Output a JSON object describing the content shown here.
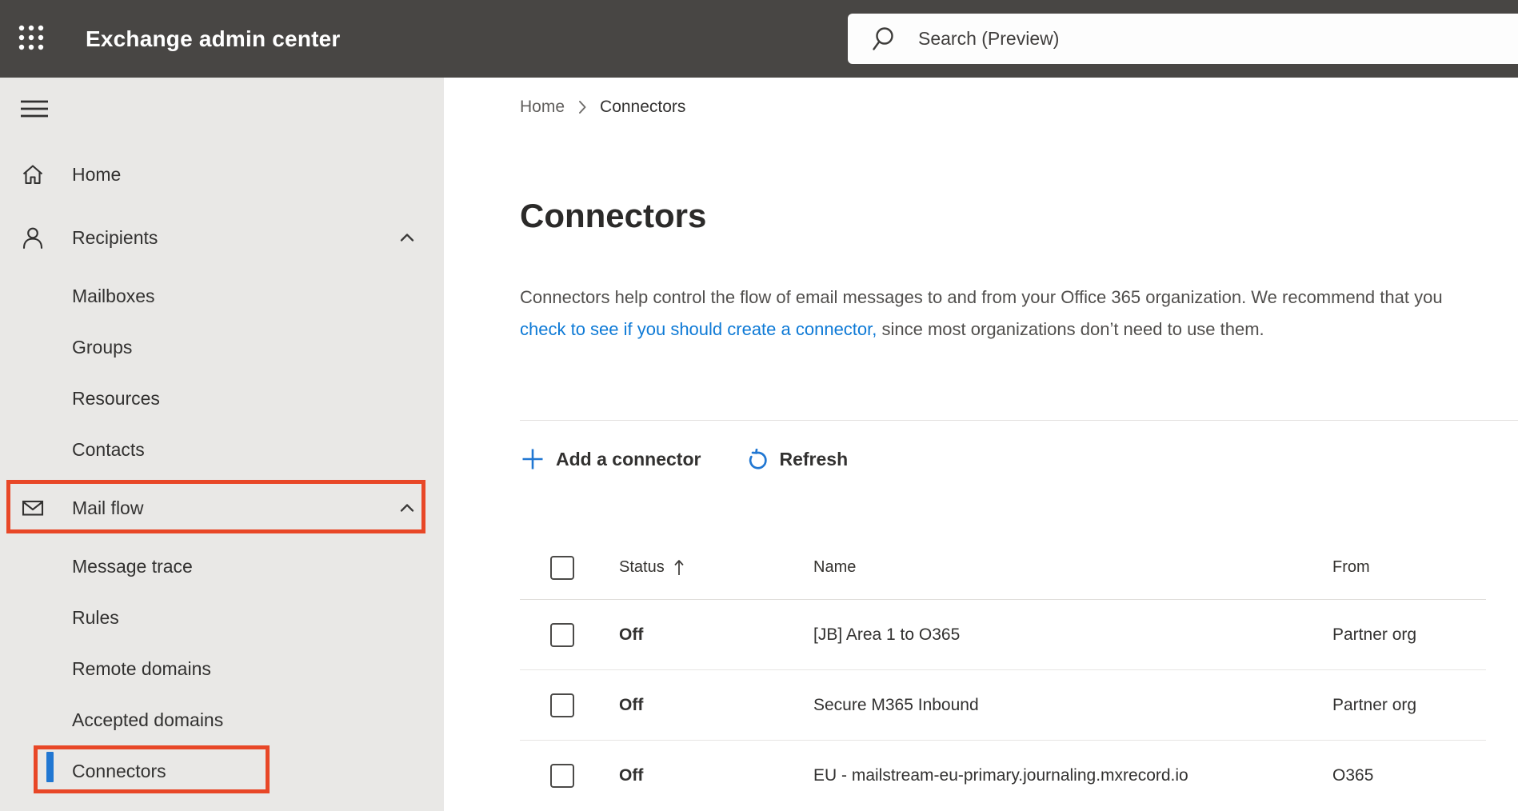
{
  "topbar": {
    "app_title": "Exchange admin center",
    "search_placeholder": "Search (Preview)"
  },
  "icons": {
    "app_launcher": "grid-3x3-dots",
    "search": "magnifier",
    "menu": "hamburger",
    "home": "house-outline",
    "recipients": "person-outline",
    "mail_flow": "envelope-outline",
    "collapse": "chevron-up",
    "breadcrumb_separator": "chevron-right",
    "add": "plus",
    "refresh": "circular-arrow",
    "sort": "arrow-up"
  },
  "colors": {
    "topbar_bg": "#484644",
    "sidebar_bg": "#e9e8e6",
    "annotation_red": "#e84727",
    "selection_blue": "#2177d2",
    "link_blue": "#0e7ad6",
    "accent_blue": "#2177d2"
  },
  "sidebar": {
    "items": [
      {
        "label": "Home",
        "level": "top",
        "icon": "house-outline"
      },
      {
        "label": "Recipients",
        "level": "top",
        "icon": "person-outline",
        "expanded": true
      },
      {
        "label": "Mailboxes",
        "level": "sub"
      },
      {
        "label": "Groups",
        "level": "sub"
      },
      {
        "label": "Resources",
        "level": "sub"
      },
      {
        "label": "Contacts",
        "level": "sub"
      },
      {
        "label": "Mail flow",
        "level": "top",
        "icon": "envelope-outline",
        "expanded": true,
        "annotated": true
      },
      {
        "label": "Message trace",
        "level": "sub"
      },
      {
        "label": "Rules",
        "level": "sub"
      },
      {
        "label": "Remote domains",
        "level": "sub"
      },
      {
        "label": "Accepted domains",
        "level": "sub"
      },
      {
        "label": "Connectors",
        "level": "sub",
        "selected": true,
        "annotated": true
      }
    ]
  },
  "breadcrumb": {
    "home": "Home",
    "current": "Connectors"
  },
  "page": {
    "title": "Connectors",
    "description_before": "Connectors help control the flow of email messages to and from your Office 365 organization. We recommend that you ",
    "description_link": "check to see if you should create a connector,",
    "description_after": " since most organizations don’t need to use them."
  },
  "toolbar": {
    "add_label": "Add a connector",
    "refresh_label": "Refresh"
  },
  "table": {
    "headers": {
      "status": "Status",
      "name": "Name",
      "from": "From"
    },
    "sort": {
      "column": "Status",
      "direction": "ascending"
    },
    "rows": [
      {
        "status": "Off",
        "name": "[JB] Area 1 to O365",
        "from": "Partner org"
      },
      {
        "status": "Off",
        "name": "Secure M365 Inbound",
        "from": "Partner org"
      },
      {
        "status": "Off",
        "name": "EU - mailstream-eu-primary.journaling.mxrecord.io",
        "from": "O365"
      }
    ]
  }
}
